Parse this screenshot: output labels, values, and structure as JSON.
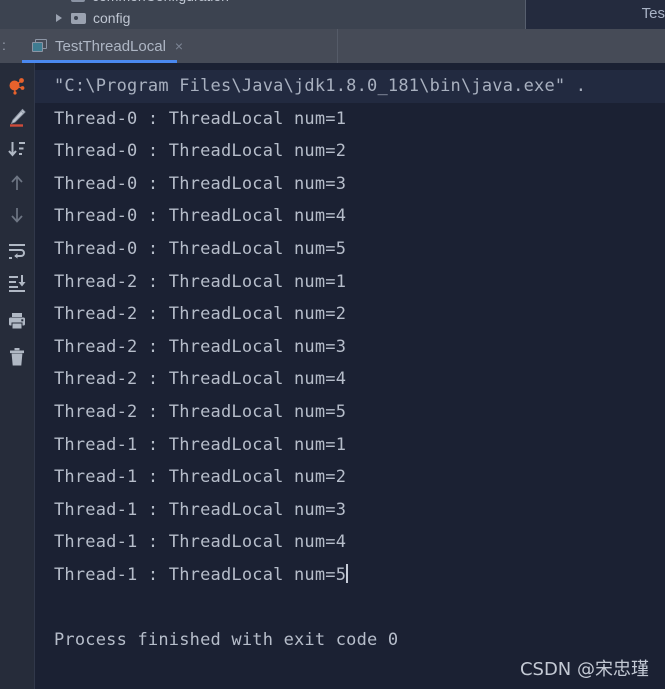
{
  "project_tree": {
    "rows": [
      {
        "label": "commonConfiguration",
        "icon": "package-icon",
        "visible": "clipped"
      },
      {
        "label": "config",
        "icon": "folder-icon",
        "visible": "full"
      }
    ]
  },
  "header": {
    "right_label": "Tes"
  },
  "tab_bar": {
    "left_marker": ":",
    "tab": {
      "label": "TestThreadLocal",
      "icon": "run-configuration-icon",
      "close_label": "×",
      "active": true,
      "accent_color": "#4a88f0"
    }
  },
  "toolbar": {
    "items": [
      {
        "name": "rerun-icon",
        "title": "Rerun",
        "color": "#e8622c"
      },
      {
        "name": "edit-configuration-icon",
        "title": "Edit Configuration",
        "color": "#c4cad4"
      },
      {
        "name": "sort-descending-icon",
        "title": "Sort",
        "color": "#b0b8c4"
      },
      {
        "name": "arrow-up-icon",
        "title": "Up the Stack Trace",
        "color": "#6e7684"
      },
      {
        "name": "arrow-down-icon",
        "title": "Down the Stack Trace",
        "color": "#6e7684"
      },
      {
        "name": "soft-wrap-icon",
        "title": "Soft-Wrap",
        "color": "#b0b8c4"
      },
      {
        "name": "scroll-to-end-icon",
        "title": "Scroll to End",
        "color": "#b0b8c4"
      },
      {
        "name": "print-icon",
        "title": "Print",
        "color": "#b0b8c4"
      },
      {
        "name": "trash-icon",
        "title": "Clear All",
        "color": "#b0b8c4"
      }
    ]
  },
  "console": {
    "lines": [
      {
        "text": "\"C:\\Program Files\\Java\\jdk1.8.0_181\\bin\\java.exe\" .",
        "type": "command"
      },
      {
        "text": "Thread-0 : ThreadLocal num=1",
        "type": "output"
      },
      {
        "text": "Thread-0 : ThreadLocal num=2",
        "type": "output"
      },
      {
        "text": "Thread-0 : ThreadLocal num=3",
        "type": "output"
      },
      {
        "text": "Thread-0 : ThreadLocal num=4",
        "type": "output"
      },
      {
        "text": "Thread-0 : ThreadLocal num=5",
        "type": "output"
      },
      {
        "text": "Thread-2 : ThreadLocal num=1",
        "type": "output"
      },
      {
        "text": "Thread-2 : ThreadLocal num=2",
        "type": "output"
      },
      {
        "text": "Thread-2 : ThreadLocal num=3",
        "type": "output"
      },
      {
        "text": "Thread-2 : ThreadLocal num=4",
        "type": "output"
      },
      {
        "text": "Thread-2 : ThreadLocal num=5",
        "type": "output"
      },
      {
        "text": "Thread-1 : ThreadLocal num=1",
        "type": "output"
      },
      {
        "text": "Thread-1 : ThreadLocal num=2",
        "type": "output"
      },
      {
        "text": "Thread-1 : ThreadLocal num=3",
        "type": "output"
      },
      {
        "text": "Thread-1 : ThreadLocal num=4",
        "type": "output"
      },
      {
        "text": "Thread-1 : ThreadLocal num=5",
        "type": "output",
        "caret": true
      },
      {
        "text": "",
        "type": "blank"
      },
      {
        "text": "Process finished with exit code 0",
        "type": "output"
      }
    ]
  },
  "watermark": {
    "text": "CSDN @宋忠瑾"
  }
}
